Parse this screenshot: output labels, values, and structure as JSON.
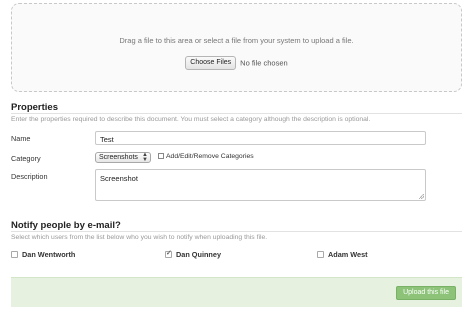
{
  "upload": {
    "instructions": "Drag a file to this area or select a file from your system to upload a file.",
    "choose_button": "Choose Files",
    "no_file": "No file chosen"
  },
  "properties": {
    "title": "Properties",
    "help": "Enter the properties required to describe this document. You must select a category although the description is optional.",
    "name_label": "Name",
    "name_value": "Test",
    "category_label": "Category",
    "category_value": "Screenshots",
    "add_categories": "Add/Edit/Remove Categories",
    "description_label": "Description",
    "description_value": "Screenshot"
  },
  "notify": {
    "title": "Notify people by e-mail?",
    "help": "Select which users from the list below who you wish to notify when uploading this file.",
    "users": [
      {
        "name": "Dan Wentworth",
        "checked": false
      },
      {
        "name": "Dan Quinney",
        "checked": true
      },
      {
        "name": "Adam West",
        "checked": false
      }
    ]
  },
  "footer": {
    "upload_button": "Upload this file"
  }
}
